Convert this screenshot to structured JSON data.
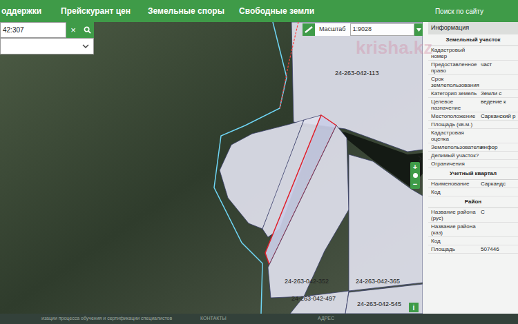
{
  "nav": {
    "items": [
      "оддержки",
      "Прейскурант цен",
      "Земельные споры",
      "Свободные земли"
    ],
    "search_link": "Поиск по сайту"
  },
  "search": {
    "value": "42:307",
    "clear": "×"
  },
  "scale": {
    "label": "Масштаб",
    "value": "1:9028"
  },
  "map": {
    "parcels": [
      {
        "label": "24-263-042-113",
        "selected": false
      },
      {
        "selected": false
      },
      {
        "selected": false
      },
      {
        "selected": true
      },
      {
        "label": "24-263-042-352",
        "selected": false
      },
      {
        "label": "24-263-042-365",
        "selected": false
      },
      {
        "label": "24-263-042-497",
        "selected": false
      },
      {
        "label": "24-263-042-545",
        "selected": false
      }
    ],
    "zoom": [
      "+",
      "−"
    ],
    "info_button": "i"
  },
  "watermark": "krisha.kz",
  "info_panel": {
    "title": "Информация",
    "sections": [
      {
        "title": "Земельный участок",
        "rows": [
          {
            "label": "Кадастровый номер"
          },
          {
            "label": "Предоставленное право",
            "value": "част"
          },
          {
            "label": "Срок землепользования"
          },
          {
            "label": "Категория земель",
            "value": "Земли с"
          },
          {
            "label": "Целевое назначение",
            "value": "ведение к"
          },
          {
            "label": "Местоположение",
            "value": "Сарканский р"
          },
          {
            "label": "Площадь (кв.м.)"
          },
          {
            "label": "Кадастровая оценка"
          },
          {
            "label": "Землепользователи",
            "value": "инфор"
          },
          {
            "label": "Делимый участок?"
          },
          {
            "label": "Ограничения"
          }
        ]
      },
      {
        "title": "Учетный квартал",
        "rows": [
          {
            "label": "Наименование",
            "value": "Саркандс"
          },
          {
            "label": "Код"
          }
        ]
      },
      {
        "title": "Район",
        "rows": [
          {
            "label": "Название района (рус)",
            "value": "С"
          },
          {
            "label": "Название района (каз)"
          },
          {
            "label": "Код"
          },
          {
            "label": "Площадь",
            "value": "507446"
          }
        ]
      }
    ]
  },
  "footer": [
    "изации процесса обучения и сертификации специалистов",
    "КОНТАКТЫ",
    "АДРЕС"
  ]
}
